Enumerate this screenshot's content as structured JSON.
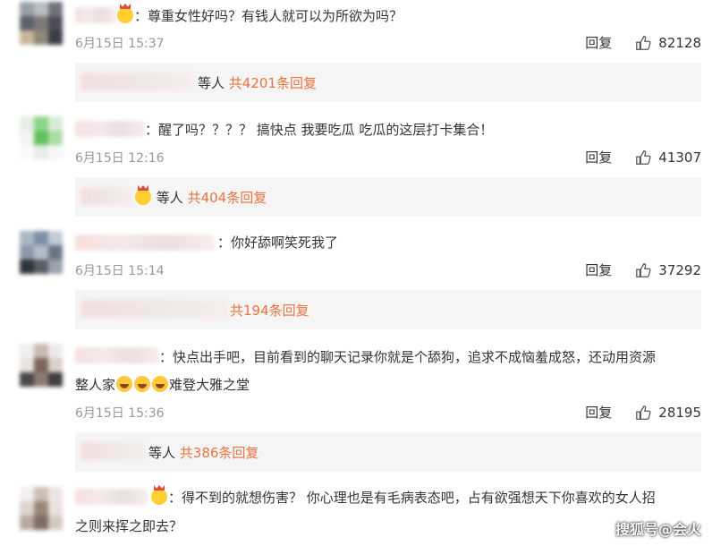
{
  "comments": [
    {
      "text": "尊重女性好吗？有钱人就可以为所欲为吗？",
      "time": "6月15日 15:37",
      "reply": "回复",
      "likes": "82128",
      "replies": {
        "suffix": "等人",
        "count": "共4201条回复"
      }
    },
    {
      "text": "醒了吗？？？？  搞快点 我要吃瓜  吃瓜的这层打卡集合！",
      "time": "6月15日 12:16",
      "reply": "回复",
      "likes": "41307",
      "replies": {
        "suffix": "等人",
        "count": "共404条回复"
      }
    },
    {
      "text": "你好舔啊笑死我了",
      "time": "6月15日 15:14",
      "reply": "回复",
      "likes": "37292",
      "replies": {
        "suffix": "",
        "count": "共194条回复"
      }
    },
    {
      "text_line1": "快点出手吧，目前看到的聊天记录你就是个舔狗，追求不成恼羞成怒，还动用资源",
      "text_line2_a": "整人家",
      "text_line2_b": "难登大雅之堂",
      "time": "6月15日 15:36",
      "reply": "回复",
      "likes": "28195",
      "replies": {
        "suffix": "等人",
        "count": "共386条回复"
      }
    },
    {
      "text_line1": "得不到的就想伤害？ 你心理也是有毛病表态吧，占有欲强想天下你喜欢的女人招",
      "text_line2": "之则来挥之即去？"
    }
  ],
  "colon": "：",
  "watermark": "搜狐号@会火",
  "colors": {
    "reply_count": "#eb7340",
    "meta": "#999999",
    "bar": "#f5f5f5"
  }
}
